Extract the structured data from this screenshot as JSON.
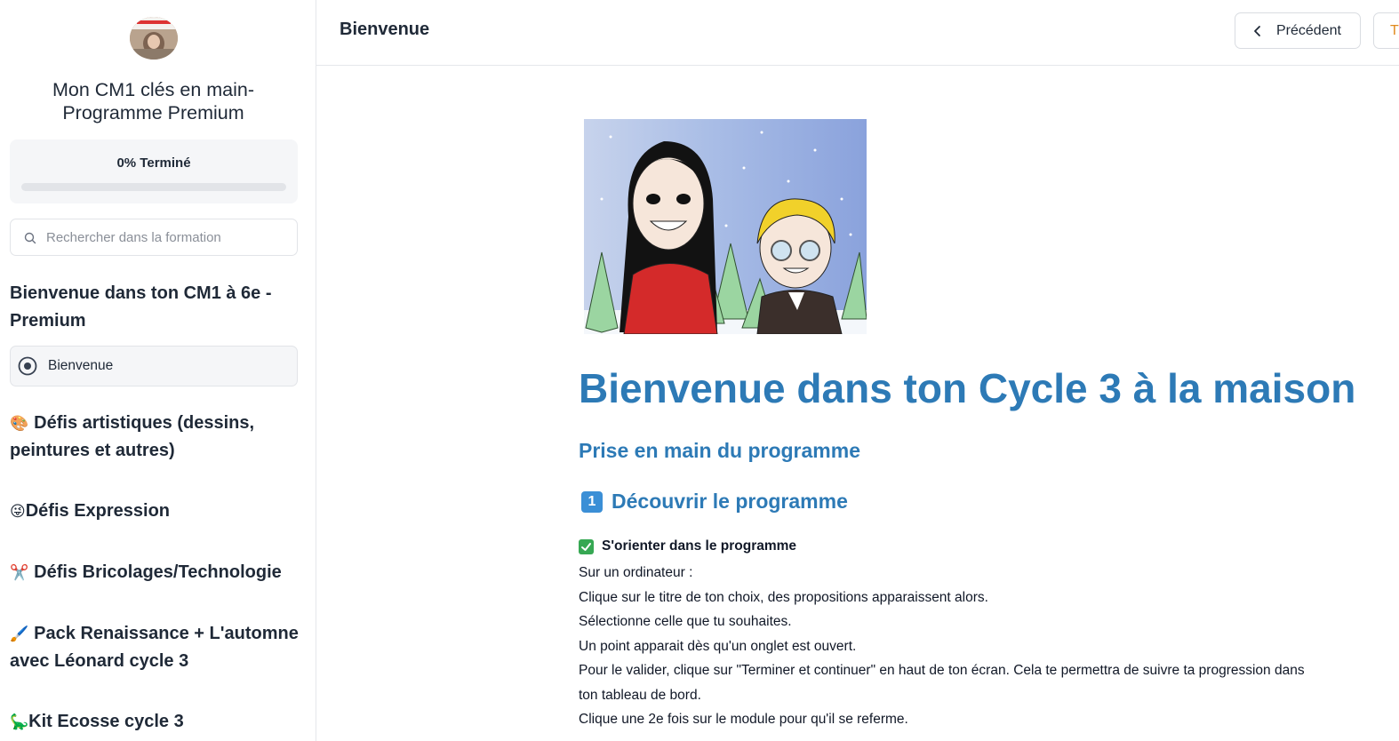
{
  "sidebar": {
    "course_title": "Mon CM1 clés en main- Programme Premium",
    "progress": {
      "label": "0% Terminé",
      "percent": 0
    },
    "search": {
      "placeholder": "Rechercher dans la formation"
    },
    "sections": [
      {
        "title": "Bienvenue dans ton CM1 à 6e - Premium",
        "icon": ""
      },
      {
        "title": "Défis artistiques (dessins, peintures et autres)",
        "icon": "🎨"
      },
      {
        "title": "Défis Expression",
        "icon": "😜"
      },
      {
        "title": "Défis Bricolages/Technologie",
        "icon": "✂️"
      },
      {
        "title": "Pack Renaissance + L'automne avec Léonard cycle 3",
        "icon": "🖌️"
      },
      {
        "title": "Kit Ecosse cycle 3",
        "icon": "🦕"
      }
    ],
    "active_lesson": {
      "label": "Bienvenue"
    }
  },
  "header": {
    "title": "Bienvenue",
    "prev_label": "Précédent",
    "next_label": "T"
  },
  "main": {
    "heading": "Bienvenue dans ton Cycle 3 à la maison",
    "subheading": "Prise en main du programme",
    "step": {
      "number": "1",
      "label": "Découvrir le programme"
    },
    "check_title": "S'orienter dans le programme",
    "lines": [
      "Sur un ordinateur :",
      "Clique sur le titre de ton choix, des propositions apparaissent alors.",
      "Sélectionne celle que tu souhaites.",
      "Un point apparait dès qu'un onglet est ouvert.",
      "Pour le valider, clique sur \"Terminer et continuer\" en haut de ton écran. Cela te permettra de suivre ta progression dans",
      "ton tableau de bord.",
      "Clique une 2e fois sur le module pour qu'il se referme."
    ]
  },
  "colors": {
    "accent": "#2d7ab6",
    "next_text": "#e08a1e"
  }
}
